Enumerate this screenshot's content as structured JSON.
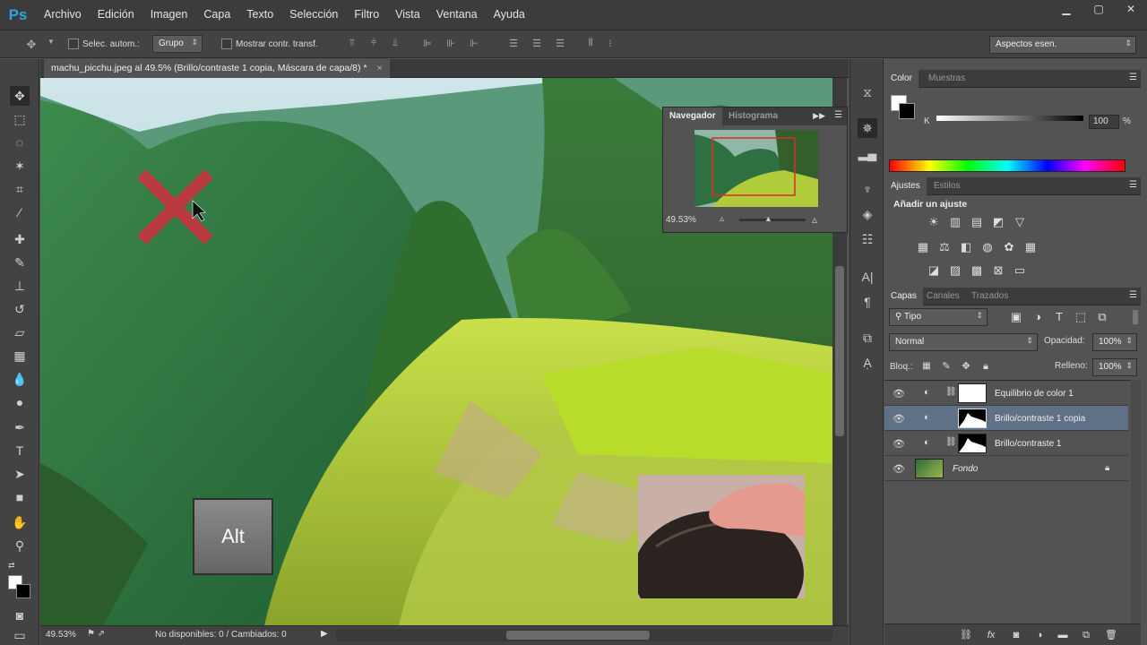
{
  "app": {
    "logo": "Ps"
  },
  "menu": [
    "Archivo",
    "Edición",
    "Imagen",
    "Capa",
    "Texto",
    "Selección",
    "Filtro",
    "Vista",
    "Ventana",
    "Ayuda"
  ],
  "options": {
    "auto_select_label": "Selec. autom.:",
    "auto_select_value": "Grupo",
    "show_transform_label": "Mostrar contr. transf.",
    "workspace": "Aspectos esen."
  },
  "document": {
    "tab_title": "machu_picchu.jpeg al 49.5% (Brillo/contraste 1 copia, Máscara de capa/8) *",
    "zoom": "49.53%",
    "status": "No disponibles: 0 / Cambiados: 0"
  },
  "overlay": {
    "key_label": "Alt"
  },
  "navigator": {
    "tabs": [
      "Navegador",
      "Histograma"
    ],
    "zoom": "49.53%"
  },
  "color_panel": {
    "tabs": [
      "Color",
      "Muestras"
    ],
    "channel": "K",
    "value": "100",
    "unit": "%"
  },
  "adjust_panel": {
    "tabs": [
      "Ajustes",
      "Estilos"
    ],
    "heading": "Añadir un ajuste"
  },
  "layers_panel": {
    "tabs": [
      "Capas",
      "Canales",
      "Trazados"
    ],
    "filter_kind": "Tipo",
    "blend_mode": "Normal",
    "opacity_label": "Opacidad:",
    "opacity": "100%",
    "lock_label": "Bloq.:",
    "fill_label": "Relleno:",
    "fill": "100%",
    "layers": [
      {
        "name": "Equilibrio de color 1"
      },
      {
        "name": "Brillo/contraste 1 copia"
      },
      {
        "name": "Brillo/contraste 1"
      },
      {
        "name": "Fondo"
      }
    ]
  },
  "colors": {
    "accent": "#29a8e0",
    "selected_layer": "#5e7186"
  }
}
